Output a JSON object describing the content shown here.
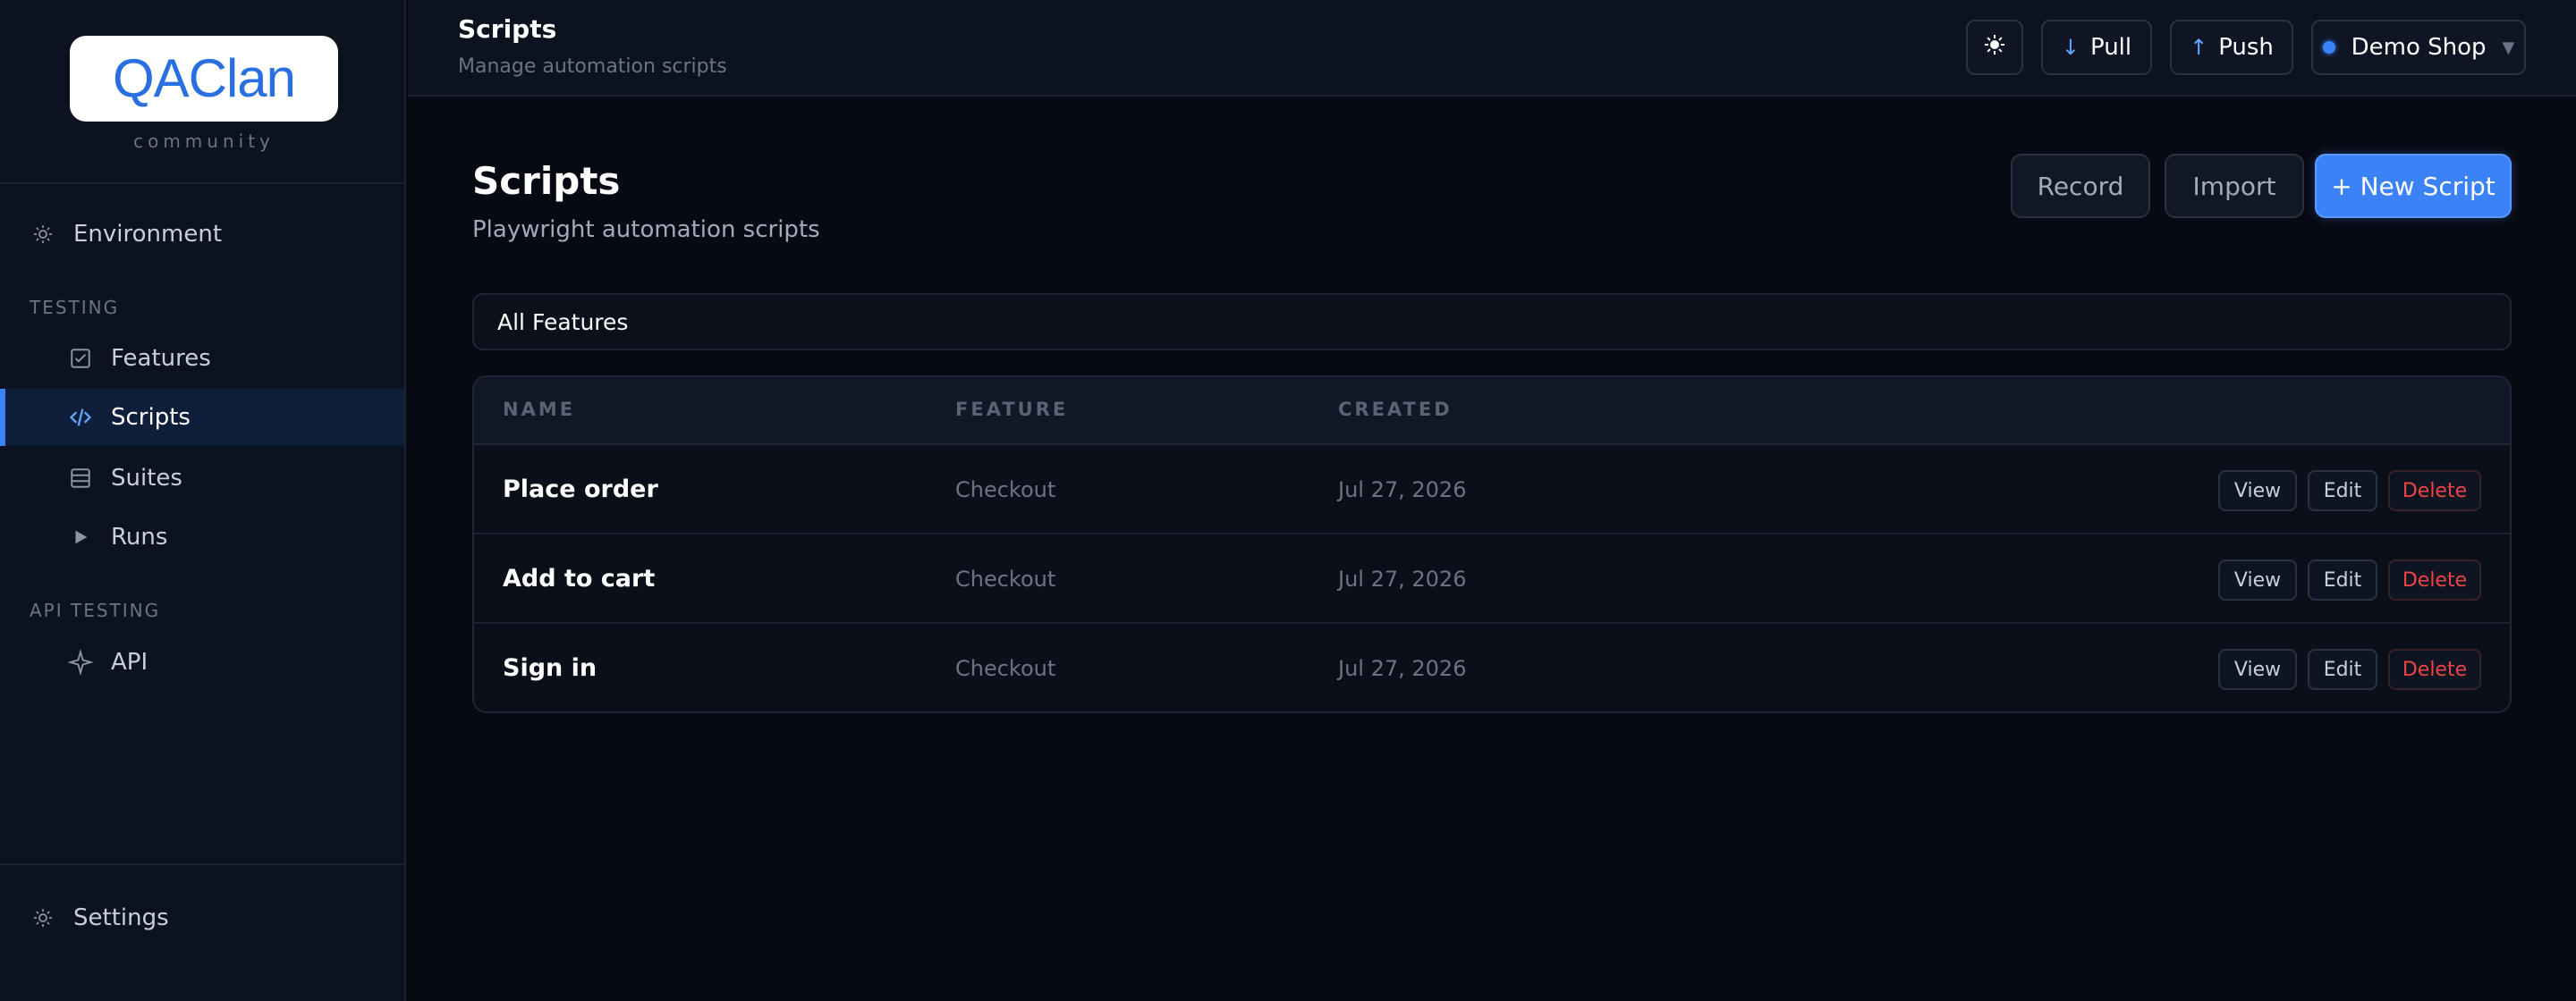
{
  "brand": {
    "logo_text": "QAClan",
    "tagline": "community"
  },
  "sidebar": {
    "environment_label": "Environment",
    "testing_section": "TESTING",
    "testing_items": [
      {
        "label": "Features",
        "icon": "checklist-icon"
      },
      {
        "label": "Scripts",
        "icon": "code-icon",
        "active": true
      },
      {
        "label": "Suites",
        "icon": "stack-icon"
      },
      {
        "label": "Runs",
        "icon": "play-icon"
      }
    ],
    "api_section": "API TESTING",
    "api_item": {
      "label": "API",
      "icon": "sparkle-icon"
    },
    "settings_label": "Settings"
  },
  "header": {
    "title": "Scripts",
    "subtitle": "Manage automation scripts",
    "theme_toggle_icon": "sun-icon",
    "pull_label": "Pull",
    "push_label": "Push",
    "shop_label": "Demo Shop"
  },
  "main": {
    "title": "Scripts",
    "subtitle": "Playwright automation scripts",
    "record_label": "Record",
    "import_label": "Import",
    "new_script_label": "+ New Script",
    "filter_value": "All Features"
  },
  "table": {
    "columns": [
      "NAME",
      "FEATURE",
      "CREATED"
    ],
    "rows": [
      {
        "name": "Place order",
        "feature": "Checkout",
        "created": "Jul 27, 2026"
      },
      {
        "name": "Add to cart",
        "feature": "Checkout",
        "created": "Jul 27, 2026"
      },
      {
        "name": "Sign in",
        "feature": "Checkout",
        "created": "Jul 27, 2026"
      }
    ],
    "actions": {
      "view": "View",
      "edit": "Edit",
      "delete": "Delete"
    }
  },
  "colors": {
    "accent": "#3b82f6",
    "danger": "#ef4444",
    "background": "#070a12",
    "sidebar": "#0d1220"
  }
}
